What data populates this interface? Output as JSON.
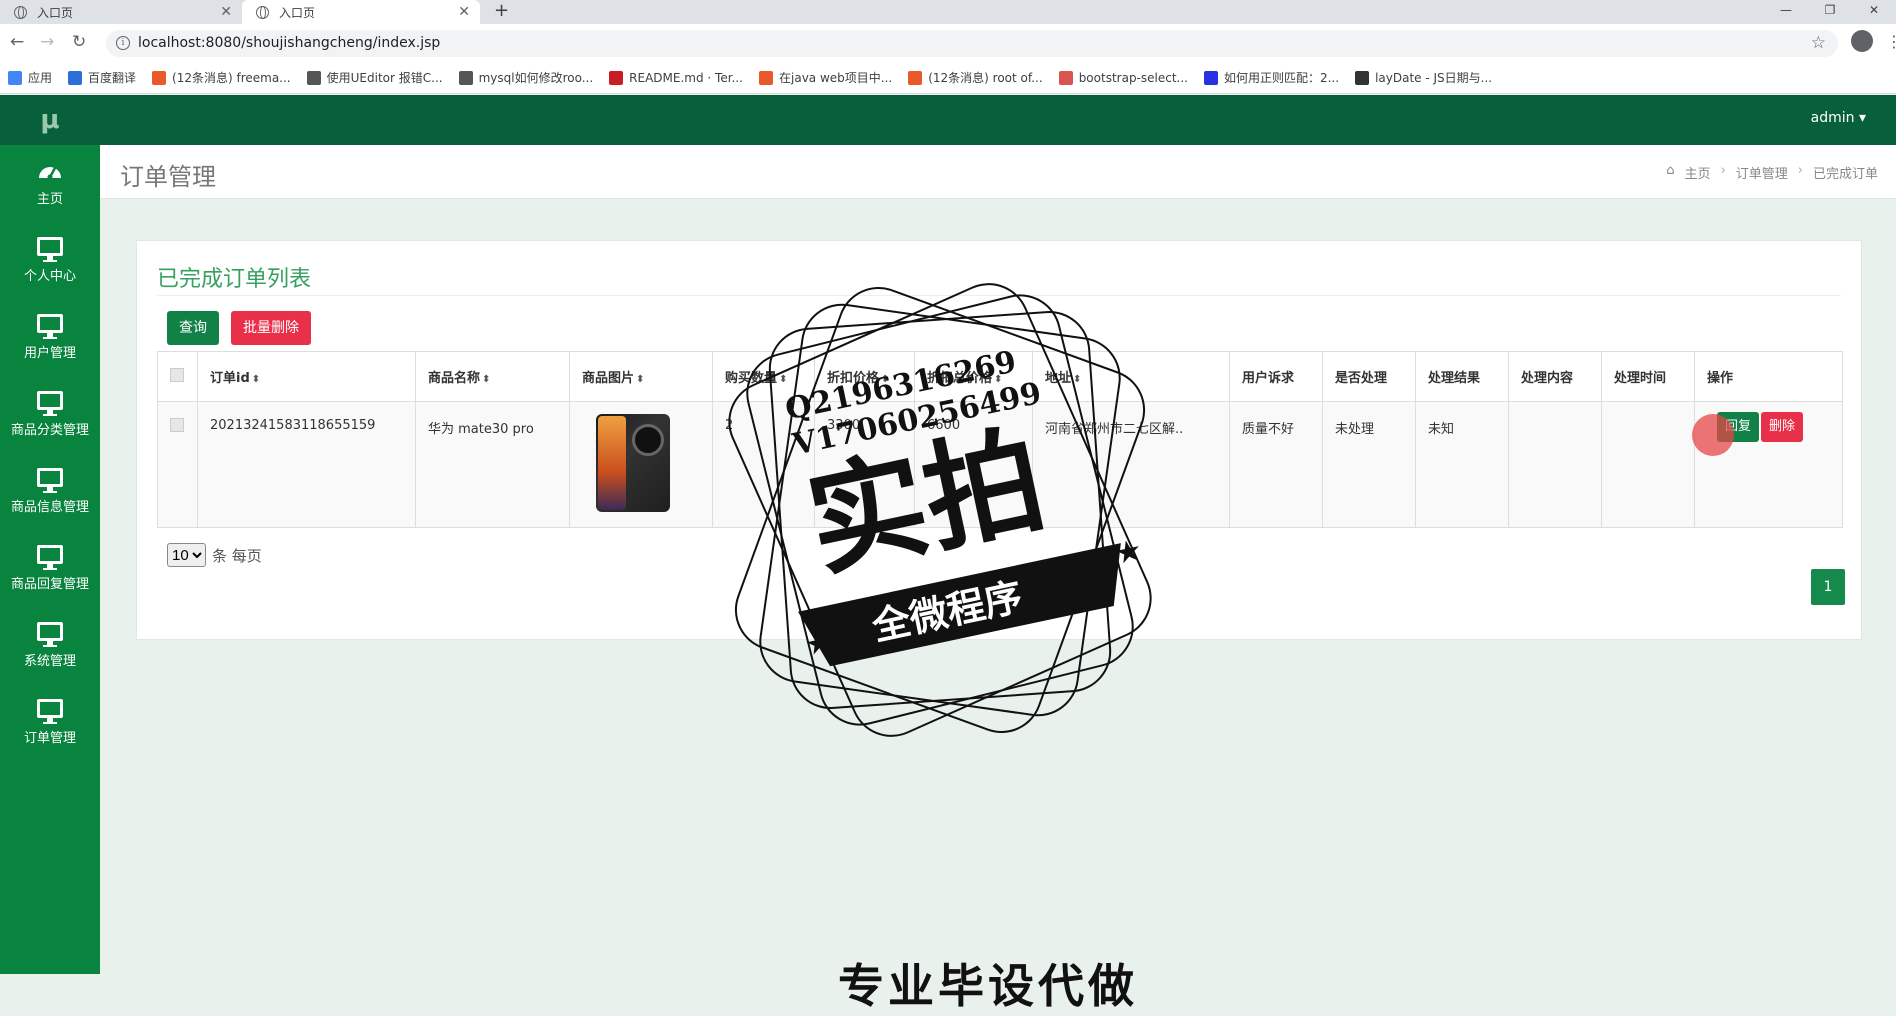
{
  "browser": {
    "tabs": [
      {
        "title": "入口页"
      },
      {
        "title": "入口页"
      }
    ],
    "url": "localhost:8080/shoujishangcheng/index.jsp",
    "bookmarks": [
      {
        "label": "应用",
        "color": "#4285f4"
      },
      {
        "label": "百度翻译",
        "color": "#2c6fd8"
      },
      {
        "label": "(12条消息) freema...",
        "color": "#e95a2b"
      },
      {
        "label": "使用UEditor 报错C...",
        "color": "#555555"
      },
      {
        "label": "mysql如何修改roo...",
        "color": "#555555"
      },
      {
        "label": "README.md · Ter...",
        "color": "#c71d23"
      },
      {
        "label": "在java web项目中...",
        "color": "#e95a2b"
      },
      {
        "label": "(12条消息) root of...",
        "color": "#e95a2b"
      },
      {
        "label": "bootstrap-select...",
        "color": "#d9534f"
      },
      {
        "label": "如何用正则匹配：2...",
        "color": "#2932e1"
      },
      {
        "label": "layDate - JS日期与...",
        "color": "#333333"
      }
    ]
  },
  "app": {
    "logo": "μ",
    "user": "admin ▾",
    "sidebar": [
      {
        "label": "主页",
        "icon": "dashboard-icon"
      },
      {
        "label": "个人中心",
        "icon": "monitor-icon"
      },
      {
        "label": "用户管理",
        "icon": "monitor-icon"
      },
      {
        "label": "商品分类管理",
        "icon": "monitor-icon"
      },
      {
        "label": "商品信息管理",
        "icon": "monitor-icon"
      },
      {
        "label": "商品回复管理",
        "icon": "monitor-icon"
      },
      {
        "label": "系统管理",
        "icon": "monitor-icon"
      },
      {
        "label": "订单管理",
        "icon": "monitor-icon"
      }
    ],
    "page_title": "订单管理",
    "breadcrumb": [
      "主页",
      "订单管理",
      "已完成订单"
    ]
  },
  "panel": {
    "title": "已完成订单列表",
    "query_label": "查询",
    "batch_delete_label": "批量删除",
    "columns": [
      "订单id",
      "商品名称",
      "商品图片",
      "购买数量",
      "折扣价格",
      "折扣总价格",
      "地址",
      "用户诉求",
      "是否处理",
      "处理结果",
      "处理内容",
      "处理时间",
      "操作"
    ],
    "rows": [
      {
        "order_id": "20213241583118655159",
        "product_name": "华为 mate30 pro",
        "qty": "2",
        "discount_price": "3300",
        "discount_total": "6600",
        "address": "河南省郑州市二七区解..",
        "user_request": "质量不好",
        "handled": "未处理",
        "result": "未知",
        "content": "",
        "time": "",
        "reply_label": "回复",
        "delete_label": "删除"
      }
    ],
    "page_size": "10",
    "page_size_suffix": "条 每页",
    "current_page": "1"
  },
  "watermark": {
    "line1": "Q2196316269",
    "line2": "V17060256499",
    "big": "实拍",
    "banner": "全微程序"
  },
  "bottom_text": "专业毕设代做"
}
